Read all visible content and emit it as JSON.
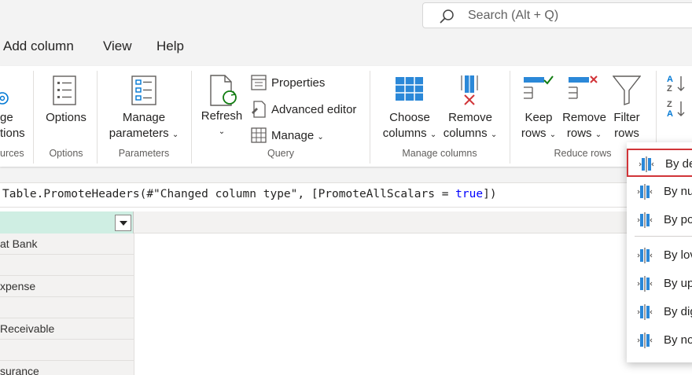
{
  "search": {
    "placeholder": "Search (Alt + Q)"
  },
  "menu_tabs": [
    "Add column",
    "View",
    "Help"
  ],
  "ribbon": {
    "sources": {
      "label_line1": "ge",
      "label_line2": "tions",
      "group": "urces"
    },
    "options": {
      "button": "Options",
      "group": "Options"
    },
    "parameters": {
      "button_line1": "Manage",
      "button_line2": "parameters",
      "group": "Parameters"
    },
    "query": {
      "refresh": "Refresh",
      "properties": "Properties",
      "advanced_editor": "Advanced editor",
      "manage": "Manage",
      "group": "Query"
    },
    "manage_columns": {
      "choose_line1": "Choose",
      "choose_line2": "columns",
      "remove_line1": "Remove",
      "remove_line2": "columns",
      "group": "Manage columns"
    },
    "reduce_rows": {
      "keep_line1": "Keep",
      "keep_line2": "rows",
      "remove_line1": "Remove",
      "remove_line2": "rows",
      "filter_line1": "Filter",
      "filter_line2": "rows",
      "group": "Reduce rows"
    }
  },
  "formula": {
    "part1": "Table.PromoteHeaders(#\"Changed column type\", [PromoteAllScalars = ",
    "keyword": "true",
    "part2": "])"
  },
  "column_cells": [
    "at Bank",
    "",
    "xpense",
    "",
    "Receivable",
    "",
    "surance"
  ],
  "split_menu": {
    "items": [
      "By de",
      "By nu",
      "By po",
      "By lov",
      "By up",
      "By dig",
      "By no"
    ],
    "selected_index": 0
  },
  "colors": {
    "accent_blue": "#0078d4",
    "selected_border": "#d13438",
    "column_header": "#cfeee3"
  }
}
